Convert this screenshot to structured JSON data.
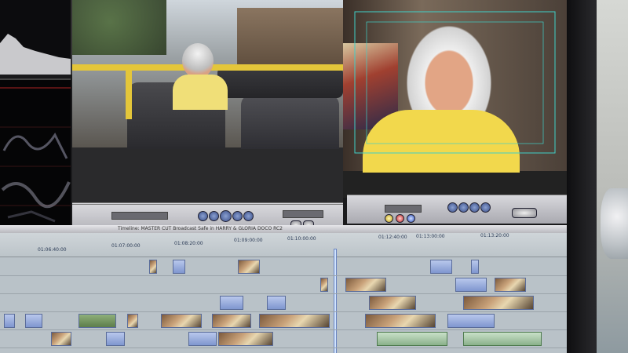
{
  "app": {
    "timeline_title": "Timeline: MASTER CUT Broadcast Safe in HARRY & GLORIA DOCO RC2"
  },
  "timeline": {
    "ruler_labels": [
      "01:06:40:00",
      "01:07:00:00",
      "01:08:20:00",
      "01:09:00:00",
      "01:10:00:00",
      "01:12:40:00",
      "01:13:00:00",
      "01:13:20:00"
    ]
  },
  "colors": {
    "selection": "#3fd0c8",
    "clip_border": "#5a6c9a",
    "timeline_bg": "#b9c2c8"
  },
  "icons": {
    "transport_left": [
      "rewind-icon",
      "step-back-icon",
      "play-icon",
      "step-forward-icon",
      "fast-forward-icon"
    ],
    "transport_right": [
      "mark-in-icon",
      "mark-out-icon",
      "play-icon",
      "loop-icon",
      "record-icon"
    ]
  }
}
